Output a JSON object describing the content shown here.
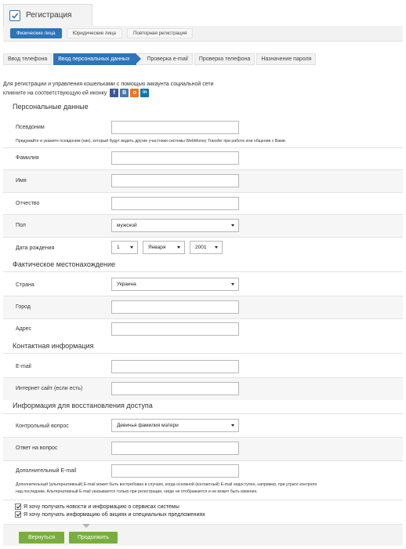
{
  "header": {
    "title": "Регистрация"
  },
  "subtabs": [
    "Физические лица",
    "Юридические лица",
    "Повторная регистрация"
  ],
  "steps": [
    "Ввод телефона",
    "Ввод персональных данных",
    "Проверка e-mail",
    "Проверка телефона",
    "Назначение пароля"
  ],
  "intro": {
    "line1": "Для регистрации и управления кошельками с помощью аккаунта социальной сети",
    "line2": "кликните на соответствующую ей иконку",
    "icons": [
      {
        "name": "facebook-icon",
        "glyph": "f",
        "color": "#3b5998"
      },
      {
        "name": "vkontakte-icon",
        "glyph": "B",
        "color": "#4a76a8"
      },
      {
        "name": "odnoklassniki-icon",
        "glyph": "o",
        "color": "#f4731c"
      },
      {
        "name": "linkedin-icon",
        "glyph": "in",
        "color": "#0e76a8"
      }
    ]
  },
  "personal": {
    "heading": "Персональные данные",
    "nickname_label": "Псевдоним",
    "nickname_hint": "Придумайте и укажите псевдоним (ник), который будут видеть другие участники системы WebMoney Transfer при работе или общении с Вами.",
    "lastname_label": "Фамилия",
    "firstname_label": "Имя",
    "patronymic_label": "Отчество",
    "gender_label": "Пол",
    "gender_value": "мужской",
    "birth_label": "Дата рождения",
    "birth_day": "1",
    "birth_month": "Января",
    "birth_year": "2001"
  },
  "location": {
    "heading": "Фактическое местонахождение",
    "country_label": "Страна",
    "country_value": "Украина",
    "city_label": "Город",
    "address_label": "Адрес"
  },
  "contact": {
    "heading": "Контактная информация",
    "email_label": "E-mail",
    "site_label": "Интернет сайт (если есть)"
  },
  "recovery": {
    "heading": "Информация для восстановления доступа",
    "question_label": "Контрольный вопрос",
    "question_value": "Девичья фамилия матери",
    "answer_label": "Ответ на вопрос",
    "extra_email_label": "Дополнительный E-mail",
    "extra_email_hint1": "Дополнительный (альтернативный) E-mail может быть востребован в случаях, когда основной (контактный) E-mail недоступен, например, при утрате контроля",
    "extra_email_hint2": "над последним. Альтернативный E-mail указывается только при регистрации, нигде не отображается и не может быть изменен."
  },
  "checks": [
    "Я хочу получать новости и информацию о сервисах системы",
    "Я хочу получать информацию об акциях и специальных предложениях"
  ],
  "buttons": {
    "back": "Вернуться",
    "next": "Продолжить"
  }
}
